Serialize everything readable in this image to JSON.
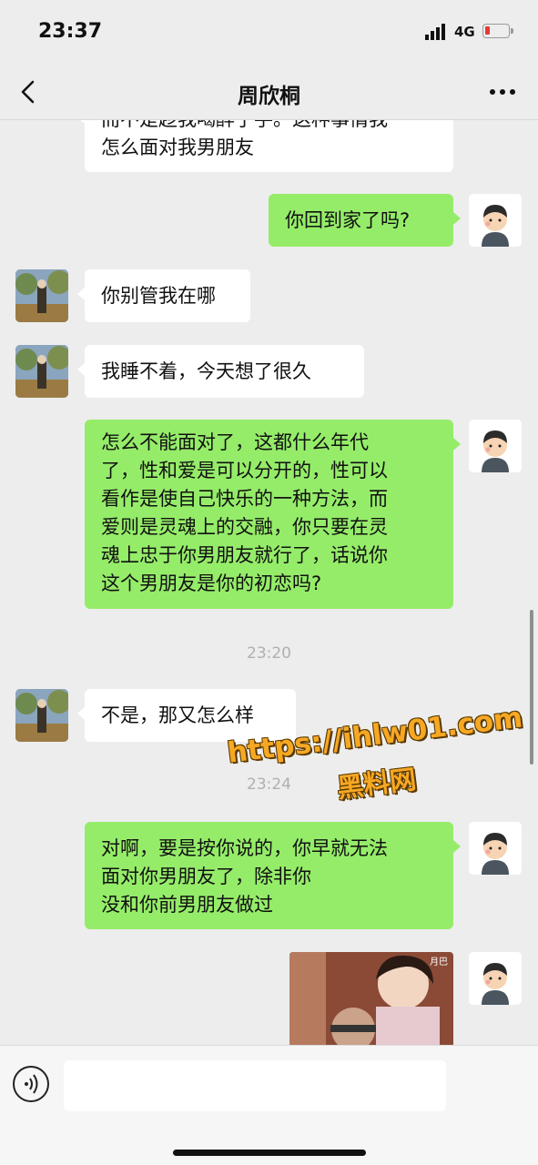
{
  "status_bar": {
    "time": "23:37",
    "network": "4G",
    "battery_color": "#e53935"
  },
  "nav": {
    "title": "周欣桐",
    "back_icon": "chevron-left-icon",
    "more_icon": "ellipsis-icon"
  },
  "messages": [
    {
      "side": "left",
      "text": "而不是趁我喝醉了手。这种事情我\n怎么面对我男朋友",
      "partially_hidden": true
    },
    {
      "side": "right",
      "text": "你回到家了吗?"
    },
    {
      "side": "left",
      "text": "你别管我在哪"
    },
    {
      "side": "left",
      "text": "我睡不着，今天想了很久"
    },
    {
      "side": "right",
      "text": "怎么不能面对了，这都什么年代\n了，性和爱是可以分开的，性可以\n看作是使自己快乐的一种方法，而\n爱则是灵魂上的交融，你只要在灵\n魂上忠于你男朋友就行了，话说你\n这个男朋友是你的初恋吗?"
    },
    {
      "type": "timestamp",
      "text": "23:20"
    },
    {
      "side": "left",
      "text": "不是，那又怎么样"
    },
    {
      "type": "timestamp",
      "text": "23:24"
    },
    {
      "side": "right",
      "text": "对啊，要是按你说的，你早就无法\n面对你男朋友了，除非你\n没和你前男朋友做过"
    },
    {
      "side": "right",
      "type": "image",
      "tag": "月巴"
    }
  ],
  "watermark": {
    "url": "https://ihlw01.com",
    "name": "黑料网"
  },
  "colors": {
    "background": "#ededed",
    "bubble_self": "#95ec69",
    "bubble_other": "#ffffff"
  }
}
